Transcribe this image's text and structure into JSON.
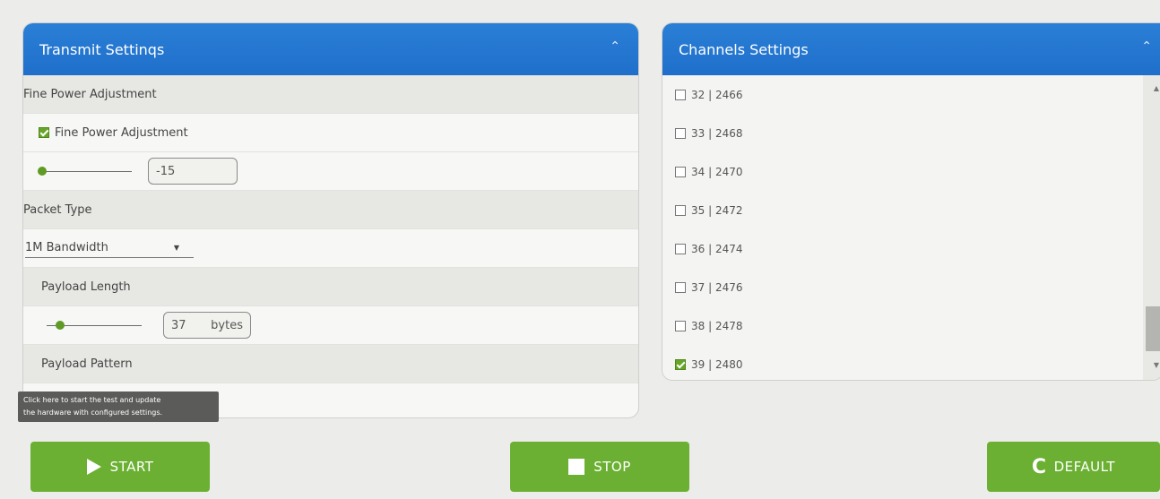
{
  "transmit": {
    "title": "Transmit Settinqs",
    "collapse_icon": "chevron-up-icon",
    "fine_power_section": "Fine Power Adjustment",
    "fine_power_checkbox_label": "Fine Power Adjustment",
    "fine_power_checked": true,
    "fine_power_value": "-15",
    "packet_type_section": "Packet Type",
    "packet_type_value": "1M Bandwidth",
    "payload_length_section": "Payload Length",
    "payload_length_value": "37",
    "payload_length_unit": "bytes",
    "payload_pattern_section": "Payload Pattern"
  },
  "tooltip": {
    "line1": "Click here to start the test and update",
    "line2": "the hardware with configured settings."
  },
  "channels": {
    "title": "Channels Settings",
    "collapse_icon": "chevron-up-icon",
    "items": [
      {
        "label": "32 | 2466",
        "checked": false
      },
      {
        "label": "33 | 2468",
        "checked": false
      },
      {
        "label": "34 | 2470",
        "checked": false
      },
      {
        "label": "35 | 2472",
        "checked": false
      },
      {
        "label": "36 | 2474",
        "checked": false
      },
      {
        "label": "37 | 2476",
        "checked": false
      },
      {
        "label": "38 | 2478",
        "checked": false
      },
      {
        "label": "39 | 2480",
        "checked": true
      }
    ]
  },
  "buttons": {
    "start": "START",
    "stop": "STOP",
    "default": "DEFAULT"
  },
  "colors": {
    "header_blue": "#2a7fd6",
    "button_green": "#6bb033",
    "checkbox_green": "#67a52a"
  }
}
